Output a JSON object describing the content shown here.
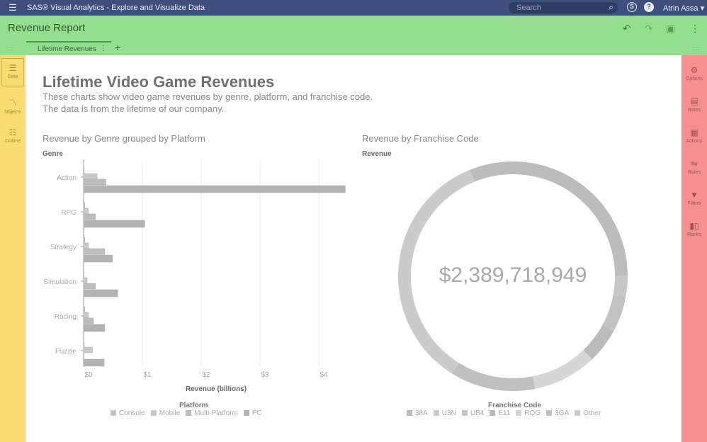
{
  "app": {
    "title": "SAS® Visual Analytics - Explore and Visualize Data",
    "search_placeholder": "Search",
    "user": "Atrin Assa"
  },
  "report": {
    "title": "Revenue Report",
    "tabs": [
      {
        "label": "Lifetime Revenues"
      }
    ],
    "add_tab": "+"
  },
  "left_sidebar": {
    "items": [
      {
        "label": "Data",
        "icon": "database-icon"
      },
      {
        "label": "Objects",
        "icon": "chart-icon"
      },
      {
        "label": "Outline",
        "icon": "list-icon"
      }
    ]
  },
  "right_sidebar": {
    "items": [
      {
        "label": "Options"
      },
      {
        "label": "Roles"
      },
      {
        "label": "Actions"
      },
      {
        "label": "Rules"
      },
      {
        "label": "Filters"
      },
      {
        "label": "Ranks"
      }
    ]
  },
  "page": {
    "title": "Lifetime Video Game Revenues",
    "description_1": "These charts show video game revenues by genre, platform, and franchise code.",
    "description_2": "The data is from the lifetime of our company."
  },
  "colors": {
    "topbar": "#3d4f7c",
    "header": "#92e08f",
    "left": "#f9dd72",
    "right": "#f59090"
  },
  "chart_data": [
    {
      "type": "bar",
      "orientation": "horizontal",
      "title": "Revenue by Genre grouped by Platform",
      "ylabel": "Genre",
      "xlabel": "Revenue (billions)",
      "categories": [
        "Action",
        "RPG",
        "Strategy",
        "Simulation",
        "Racing",
        "Puzzle"
      ],
      "series": [
        {
          "name": "Console",
          "values": [
            0.01,
            0.02,
            0.02,
            0.01,
            0.02,
            0.01
          ],
          "color": "#c4c4c4"
        },
        {
          "name": "Mobile",
          "values": [
            0.23,
            0.08,
            0.08,
            0.06,
            0.08,
            0.15
          ],
          "color": "#c9c9c9"
        },
        {
          "name": "Multi-Platform",
          "values": [
            0.38,
            0.2,
            0.36,
            0.2,
            0.17,
            0.0
          ],
          "color": "#bdbdbd"
        },
        {
          "name": "PC",
          "values": [
            4.45,
            1.04,
            0.49,
            0.58,
            0.36,
            0.35
          ],
          "color": "#b3b3b3"
        }
      ],
      "xticks": [
        "$0",
        "$1",
        "$2",
        "$3",
        "$4"
      ],
      "xlim": [
        0,
        4.45
      ],
      "legend_title": "Platform",
      "legend": "bottom"
    },
    {
      "type": "pie",
      "subtype": "donut",
      "title": "Revenue by Franchise Code",
      "label": "Revenue",
      "center_value": "$2,389,718,949",
      "legend_title": "Franchise Code",
      "legend": "bottom",
      "slices": [
        {
          "name": "38A",
          "fraction": 0.31,
          "color": "#bcbcbc"
        },
        {
          "name": "U3N",
          "fraction": 0.03,
          "color": "#c8c8c8"
        },
        {
          "name": "UB4",
          "fraction": 0.05,
          "color": "#c2c2c2"
        },
        {
          "name": "E11",
          "fraction": 0.05,
          "color": "#bababa"
        },
        {
          "name": "RQG",
          "fraction": 0.09,
          "color": "#d6d6d6"
        },
        {
          "name": "3GA",
          "fraction": 0.12,
          "color": "#c0c0c0"
        },
        {
          "name": "Other",
          "fraction": 0.35,
          "color": "#cbcbcb"
        }
      ]
    }
  ]
}
